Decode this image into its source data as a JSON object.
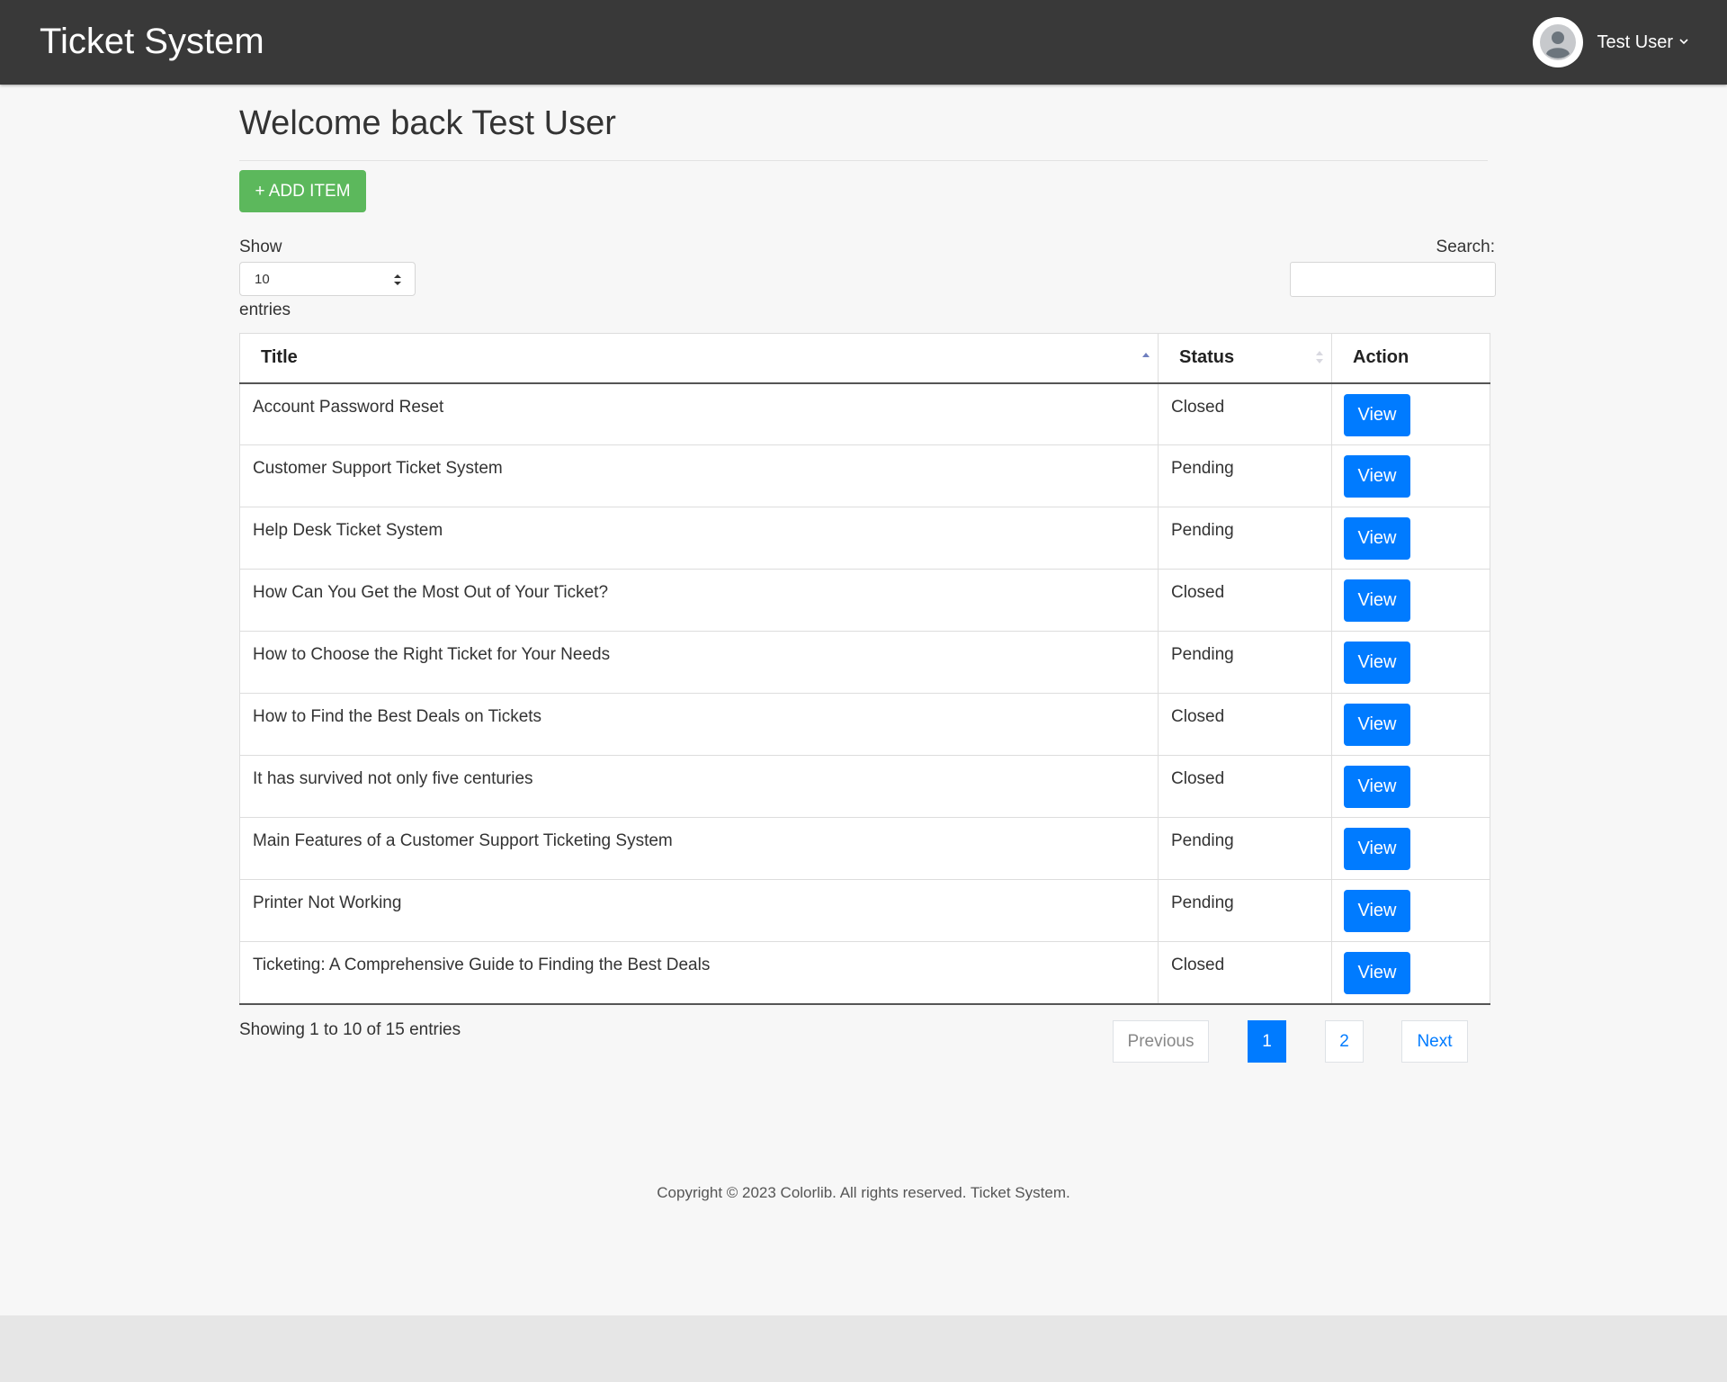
{
  "header": {
    "brand": "Ticket System",
    "user_name": "Test User"
  },
  "main": {
    "welcome": "Welcome back Test User",
    "add_button": "+ ADD ITEM",
    "length_menu": {
      "show_label": "Show",
      "selected": "10",
      "entries_label": "entries"
    },
    "search": {
      "label": "Search:",
      "value": "",
      "placeholder": ""
    },
    "table": {
      "columns": [
        "Title",
        "Status",
        "Action"
      ],
      "sorted_column": "Title",
      "sort_direction": "ascending",
      "rows": [
        {
          "title": "Account Password Reset",
          "status": "Closed",
          "action": "View"
        },
        {
          "title": "Customer Support Ticket System",
          "status": "Pending",
          "action": "View"
        },
        {
          "title": "Help Desk Ticket System",
          "status": "Pending",
          "action": "View"
        },
        {
          "title": "How Can You Get the Most Out of Your Ticket?",
          "status": "Closed",
          "action": "View"
        },
        {
          "title": "How to Choose the Right Ticket for Your Needs",
          "status": "Pending",
          "action": "View"
        },
        {
          "title": "How to Find the Best Deals on Tickets",
          "status": "Closed",
          "action": "View"
        },
        {
          "title": "It has survived not only five centuries",
          "status": "Closed",
          "action": "View"
        },
        {
          "title": "Main Features of a Customer Support Ticketing System",
          "status": "Pending",
          "action": "View"
        },
        {
          "title": "Printer Not Working",
          "status": "Pending",
          "action": "View"
        },
        {
          "title": "Ticketing: A Comprehensive Guide to Finding the Best Deals",
          "status": "Closed",
          "action": "View"
        }
      ]
    },
    "info": "Showing 1 to 10 of 15 entries",
    "pagination": {
      "previous": "Previous",
      "pages": [
        "1",
        "2"
      ],
      "current": "1",
      "next": "Next"
    }
  },
  "footer": {
    "copyright": "Copyright © 2023 Colorlib. All rights reserved. Ticket System."
  },
  "colors": {
    "header_bg": "#393939",
    "add_button": "#5cb85c",
    "primary": "#007bff",
    "page_bg": "#f7f7f7"
  }
}
